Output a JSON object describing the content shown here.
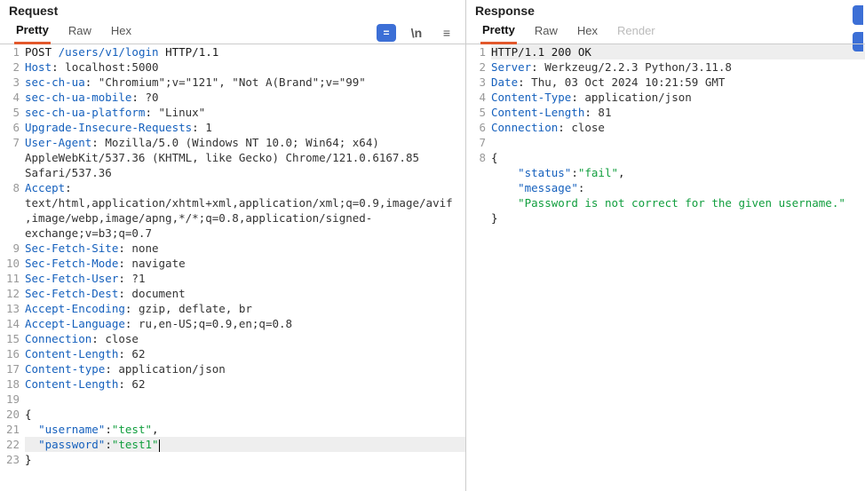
{
  "request": {
    "title": "Request",
    "tabs": {
      "pretty": "Pretty",
      "raw": "Raw",
      "hex": "Hex"
    },
    "tool_primary_glyph": "=",
    "tool_newline_glyph": "\\n",
    "tool_menu_glyph": "≡",
    "http": {
      "method": "POST",
      "path": "/users/v1/login",
      "version": "HTTP/1.1"
    },
    "headers": {
      "Host": "localhost:5000",
      "sec-ch-ua": "\"Chromium\";v=\"121\", \"Not A(Brand\";v=\"99\"",
      "sec-ch-ua-mobile": "?0",
      "sec-ch-ua-platform": "\"Linux\"",
      "Upgrade-Insecure-Requests": "1",
      "User-Agent": "Mozilla/5.0 (Windows NT 10.0; Win64; x64) AppleWebKit/537.36 (KHTML, like Gecko) Chrome/121.0.6167.85 Safari/537.36",
      "Accept": "text/html,application/xhtml+xml,application/xml;q=0.9,image/avif,image/webp,image/apng,*/*;q=0.8,application/signed-exchange;v=b3;q=0.7",
      "Sec-Fetch-Site": "none",
      "Sec-Fetch-Mode": "navigate",
      "Sec-Fetch-User": "?1",
      "Sec-Fetch-Dest": "document",
      "Accept-Encoding": "gzip, deflate, br",
      "Accept-Language": "ru,en-US;q=0.9,en;q=0.8",
      "Connection": "close",
      "Content-Length": "62",
      "Content-type": "application/json",
      "Content-Length2": "62"
    },
    "body": {
      "open": "{",
      "k_username": "\"username\"",
      "v_username": "\"test\"",
      "k_password": "\"password\"",
      "v_password": "\"test1\"",
      "close": "}"
    }
  },
  "response": {
    "title": "Response",
    "tabs": {
      "pretty": "Pretty",
      "raw": "Raw",
      "hex": "Hex",
      "render": "Render"
    },
    "status_line": "HTTP/1.1 200 OK",
    "headers": {
      "Server": "Werkzeug/2.2.3 Python/3.11.8",
      "Date": "Thu, 03 Oct 2024 10:21:59 GMT",
      "Content-Type": "application/json",
      "Content-Length": "81",
      "Connection": "close"
    },
    "body": {
      "open": "{",
      "k_status": "\"status\"",
      "v_status": "\"fail\"",
      "k_message": "\"message\"",
      "v_message": "\"Password is not correct for the given username.\"",
      "close": "}"
    }
  }
}
